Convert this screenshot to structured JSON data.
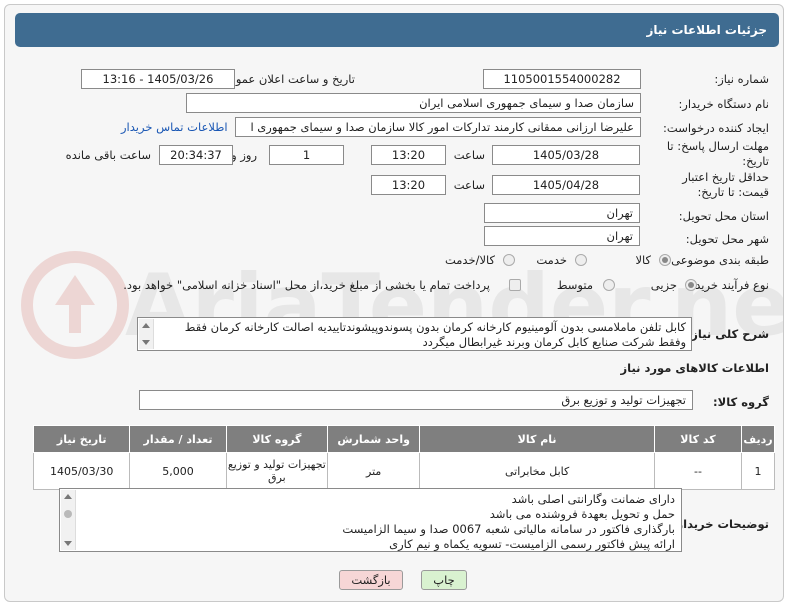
{
  "title": "جزئیات اطلاعات نیاز",
  "labels": {
    "need_number": "شماره نیاز:",
    "announce_datetime": "تاریخ و ساعت اعلان عمومی:",
    "buyer_org": "نام دستگاه خریدار:",
    "creator": "ایجاد کننده درخواست:",
    "reply_deadline": "مهلت ارسال پاسخ: تا تاریخ:",
    "price_validity": "حداقل تاریخ اعتبار قیمت: تا تاریخ:",
    "time": "ساعت",
    "day_and": "روز و",
    "time_remaining": "ساعت باقی مانده",
    "province": "استان محل تحویل:",
    "city": "شهر محل تحویل:",
    "category": "طبقه بندی موضوعی:",
    "process_type": "نوع فرآیند خرید :",
    "general_desc": "شرح کلی نیاز:",
    "goods_info": "اطلاعات کالاهای مورد نیاز",
    "goods_group": "گروه کالا:",
    "buyer_notes": "توضیحات خریدار:"
  },
  "need_number": "1105001554000282",
  "announce_datetime": "1405/03/26 - 13:16",
  "buyer_org": "سازمان صدا و سیمای جمهوری اسلامی ایران",
  "creator": "علیرضا ارزانی ممقانی کارمند تدارکات امور کالا سازمان صدا و سیمای جمهوری ا",
  "contact_link": "اطلاعات تماس خریدار",
  "reply_deadline": {
    "date": "1405/03/28",
    "time": "13:20",
    "days": "1",
    "remaining": "20:34:37"
  },
  "price_validity": {
    "date": "1405/04/28",
    "time": "13:20"
  },
  "province": "تهران",
  "city": "تهران",
  "category_options": {
    "goods": "کالا",
    "service": "خدمت",
    "goods_service": "کالا/خدمت",
    "selected": "کالا"
  },
  "process_options": {
    "partial": "جزیی",
    "medium": "متوسط",
    "selected": "جزیی"
  },
  "payment_note": "پرداخت تمام یا بخشی از مبلغ خرید،از محل \"اسناد خزانه اسلامی\" خواهد بود.",
  "general_desc": "کابل تلفن ماملامسی بدون آلومینیوم کارخانه کرمان بدون پسوندوپیشوندتاییدیه اصالت کارخانه کرمان فقط وفقط شرکت صنایع کابل کرمان وبرند غیرابطال میگردد",
  "goods_group": "تجهیزات تولید و توزیع برق",
  "table": {
    "headers": [
      "ردیف",
      "کد کالا",
      "نام کالا",
      "واحد شمارش",
      "گروه کالا",
      "تعداد / مقدار",
      "تاریخ نیاز"
    ],
    "rows": [
      [
        "1",
        "--",
        "کابل مخابراتی",
        "متر",
        "تجهیزات تولید و توزیع برق",
        "5,000",
        "1405/03/30"
      ]
    ]
  },
  "buyer_notes": [
    "دارای ضمانت وگارانتی اصلی باشد",
    "حمل و تحویل بعهدة فروشنده می باشد",
    "بارگذاری فاکتور در سامانه مالیاتی شعبه 0067 صدا و سیما الزامیست",
    "ارائه پیش فاکتور رسمی الزامیست- تسویه یکماه و نیم کاری"
  ],
  "buttons": {
    "print": "چاپ",
    "back": "بازگشت"
  },
  "watermark": "AriaTender.net",
  "colors": {
    "title_bg": "#3f6c91",
    "table_header_bg": "#7f7f7f",
    "print_btn": "#d9f2d0",
    "back_btn": "#f6d6d6"
  }
}
